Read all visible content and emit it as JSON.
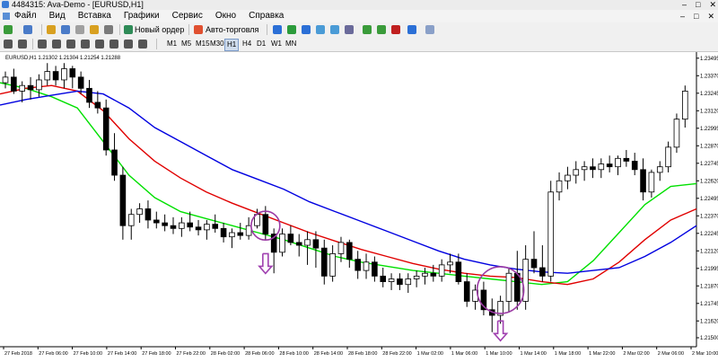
{
  "window": {
    "title": "4484315: Ava-Demo - [EURUSD,H1]",
    "buttons": [
      "–",
      "□",
      "✕"
    ]
  },
  "menu": {
    "items": [
      "Файл",
      "Вид",
      "Вставка",
      "Графики",
      "Сервис",
      "Окно",
      "Справка"
    ],
    "mdi": [
      "–",
      "□",
      "✕"
    ]
  },
  "toolbar": {
    "new_order": "Новый ордер",
    "auto_trading": "Авто-торговля"
  },
  "timeframes": [
    "M1",
    "M5",
    "M15",
    "M30",
    "H1",
    "H4",
    "D1",
    "W1",
    "MN"
  ],
  "chart_info": "EURUSD,H1  1.21302 1.21304 1.21254 1.21288",
  "colors": {
    "bull": "#ffffff",
    "bear": "#000000",
    "ma_fast": "#00e000",
    "ma_mid": "#e00000",
    "ma_slow": "#0000e0",
    "annotation": "#9b3aa4",
    "arrow": "#a040b0"
  },
  "chart_data": {
    "type": "candlestick",
    "symbol": "EURUSD",
    "timeframe": "H1",
    "price_labels": [
      "1.23495",
      "1.23370",
      "1.23245",
      "1.23120",
      "1.22995",
      "1.22870",
      "1.22745",
      "1.22620",
      "1.22495",
      "1.22370",
      "1.22245",
      "1.22120",
      "1.21995",
      "1.21870",
      "1.21745",
      "1.21620",
      "1.21500"
    ],
    "ylim": [
      1.215,
      1.235
    ],
    "time_labels": [
      "27 Feb 2018",
      "27 Feb 06:00",
      "27 Feb 10:00",
      "27 Feb 14:00",
      "27 Feb 18:00",
      "27 Feb 22:00",
      "28 Feb 02:00",
      "28 Feb 06:00",
      "28 Feb 10:00",
      "28 Feb 14:00",
      "28 Feb 18:00",
      "28 Feb 22:00",
      "1 Mar 02:00",
      "1 Mar 06:00",
      "1 Mar 10:00",
      "1 Mar 14:00",
      "1 Mar 18:00",
      "1 Mar 22:00",
      "2 Mar 02:00",
      "2 Mar 06:00",
      "2 Mar 10:00"
    ],
    "candles": [
      [
        1.2332,
        1.234,
        1.2328,
        1.2336
      ],
      [
        1.2336,
        1.2342,
        1.2324,
        1.2326
      ],
      [
        1.2326,
        1.2333,
        1.2318,
        1.233
      ],
      [
        1.233,
        1.2336,
        1.232,
        1.2327
      ],
      [
        1.2327,
        1.2338,
        1.2322,
        1.2334
      ],
      [
        1.2334,
        1.2346,
        1.233,
        1.234
      ],
      [
        1.234,
        1.2344,
        1.233,
        1.2334
      ],
      [
        1.2334,
        1.2346,
        1.2328,
        1.2342
      ],
      [
        1.2342,
        1.2344,
        1.2328,
        1.2336
      ],
      [
        1.2336,
        1.234,
        1.2324,
        1.2328
      ],
      [
        1.2328,
        1.2334,
        1.2314,
        1.2318
      ],
      [
        1.2318,
        1.2326,
        1.231,
        1.2314
      ],
      [
        1.2314,
        1.232,
        1.228,
        1.2284
      ],
      [
        1.2284,
        1.2296,
        1.2262,
        1.2266
      ],
      [
        1.2266,
        1.2272,
        1.222,
        1.223
      ],
      [
        1.223,
        1.2242,
        1.222,
        1.2238
      ],
      [
        1.2238,
        1.2246,
        1.2232,
        1.2242
      ],
      [
        1.2242,
        1.2248,
        1.2228,
        1.2234
      ],
      [
        1.2234,
        1.224,
        1.2228,
        1.2232
      ],
      [
        1.2232,
        1.2238,
        1.2226,
        1.223
      ],
      [
        1.223,
        1.2236,
        1.2224,
        1.2228
      ],
      [
        1.2228,
        1.2236,
        1.2222,
        1.2232
      ],
      [
        1.2232,
        1.224,
        1.2226,
        1.2229
      ],
      [
        1.2229,
        1.2234,
        1.2223,
        1.2227
      ],
      [
        1.2227,
        1.2234,
        1.222,
        1.2231
      ],
      [
        1.2231,
        1.2238,
        1.2225,
        1.2228
      ],
      [
        1.2228,
        1.2232,
        1.2218,
        1.2222
      ],
      [
        1.2222,
        1.2228,
        1.2214,
        1.2225
      ],
      [
        1.2225,
        1.2232,
        1.222,
        1.2223
      ],
      [
        1.2223,
        1.2236,
        1.222,
        1.223
      ],
      [
        1.223,
        1.2242,
        1.2228,
        1.2238
      ],
      [
        1.2238,
        1.2244,
        1.222,
        1.2224
      ],
      [
        1.2224,
        1.2228,
        1.2196,
        1.2211
      ],
      [
        1.2211,
        1.2228,
        1.2208,
        1.2224
      ],
      [
        1.2224,
        1.223,
        1.2216,
        1.2218
      ],
      [
        1.2218,
        1.2224,
        1.2208,
        1.2216
      ],
      [
        1.2216,
        1.2226,
        1.2202,
        1.222
      ],
      [
        1.222,
        1.2226,
        1.22,
        1.2214
      ],
      [
        1.2214,
        1.222,
        1.2188,
        1.2194
      ],
      [
        1.2194,
        1.2216,
        1.219,
        1.221
      ],
      [
        1.221,
        1.2222,
        1.2204,
        1.2218
      ],
      [
        1.2218,
        1.222,
        1.22,
        1.2206
      ],
      [
        1.2206,
        1.2212,
        1.2192,
        1.2198
      ],
      [
        1.2198,
        1.221,
        1.2192,
        1.2204
      ],
      [
        1.2204,
        1.2208,
        1.219,
        1.2194
      ],
      [
        1.2194,
        1.22,
        1.2186,
        1.219
      ],
      [
        1.219,
        1.2196,
        1.2184,
        1.2192
      ],
      [
        1.2192,
        1.2196,
        1.2184,
        1.2188
      ],
      [
        1.2188,
        1.2196,
        1.2182,
        1.2192
      ],
      [
        1.2192,
        1.2198,
        1.2186,
        1.2194
      ],
      [
        1.2194,
        1.22,
        1.2188,
        1.2196
      ],
      [
        1.2196,
        1.2202,
        1.219,
        1.2194
      ],
      [
        1.2194,
        1.2206,
        1.219,
        1.2202
      ],
      [
        1.2202,
        1.221,
        1.2196,
        1.2204
      ],
      [
        1.2204,
        1.221,
        1.2188,
        1.219
      ],
      [
        1.219,
        1.2196,
        1.2172,
        1.2176
      ],
      [
        1.2176,
        1.2188,
        1.217,
        1.2184
      ],
      [
        1.2184,
        1.219,
        1.2166,
        1.217
      ],
      [
        1.217,
        1.2178,
        1.2154,
        1.2166
      ],
      [
        1.2166,
        1.218,
        1.216,
        1.2176
      ],
      [
        1.2176,
        1.22,
        1.2168,
        1.2196
      ],
      [
        1.2196,
        1.2212,
        1.217,
        1.2176
      ],
      [
        1.2176,
        1.2216,
        1.217,
        1.2206
      ],
      [
        1.2206,
        1.2226,
        1.2196,
        1.22
      ],
      [
        1.22,
        1.2216,
        1.219,
        1.2194
      ],
      [
        1.2194,
        1.2262,
        1.219,
        1.2254
      ],
      [
        1.2254,
        1.2268,
        1.2248,
        1.2262
      ],
      [
        1.2262,
        1.2272,
        1.2256,
        1.2266
      ],
      [
        1.2266,
        1.2276,
        1.226,
        1.227
      ],
      [
        1.227,
        1.2276,
        1.2262,
        1.2272
      ],
      [
        1.2272,
        1.2278,
        1.2264,
        1.227
      ],
      [
        1.227,
        1.2278,
        1.2264,
        1.2274
      ],
      [
        1.2274,
        1.228,
        1.2268,
        1.2272
      ],
      [
        1.2272,
        1.228,
        1.2266,
        1.2278
      ],
      [
        1.2278,
        1.2284,
        1.2272,
        1.2276
      ],
      [
        1.2276,
        1.2282,
        1.2266,
        1.227
      ],
      [
        1.227,
        1.2278,
        1.2248,
        1.2254
      ],
      [
        1.2254,
        1.227,
        1.225,
        1.2268
      ],
      [
        1.2268,
        1.2276,
        1.2262,
        1.2272
      ],
      [
        1.2272,
        1.229,
        1.2268,
        1.2286
      ],
      [
        1.2286,
        1.231,
        1.2282,
        1.2306
      ],
      [
        1.2306,
        1.233,
        1.23,
        1.2326
      ]
    ],
    "series": [
      {
        "name": "MA fast",
        "color": "#00e000",
        "values": [
          1.2332,
          1.2328,
          1.2322,
          1.2314,
          1.229,
          1.2266,
          1.225,
          1.224,
          1.2235,
          1.223,
          1.2225,
          1.222,
          1.2214,
          1.2208,
          1.2204,
          1.2201,
          1.2198,
          1.2196,
          1.2194,
          1.2192,
          1.219,
          1.2188,
          1.219,
          1.2205,
          1.2225,
          1.2245,
          1.2258,
          1.226
        ]
      },
      {
        "name": "MA mid",
        "color": "#e00000",
        "values": [
          1.2324,
          1.2328,
          1.233,
          1.2326,
          1.2312,
          1.2292,
          1.2276,
          1.2264,
          1.2254,
          1.2246,
          1.2239,
          1.2232,
          1.2225,
          1.2219,
          1.2213,
          1.2208,
          1.2203,
          1.2199,
          1.2196,
          1.2194,
          1.2193,
          1.219,
          1.2188,
          1.2192,
          1.2204,
          1.222,
          1.2234,
          1.2242
        ]
      },
      {
        "name": "MA slow",
        "color": "#0000e0",
        "values": [
          1.2316,
          1.232,
          1.2323,
          1.2326,
          1.2324,
          1.2314,
          1.23,
          1.229,
          1.228,
          1.227,
          1.2263,
          1.2256,
          1.2247,
          1.224,
          1.2233,
          1.2226,
          1.2219,
          1.2212,
          1.2206,
          1.2202,
          1.2199,
          1.2197,
          1.2196,
          1.2198,
          1.22,
          1.2208,
          1.2218,
          1.223
        ]
      }
    ],
    "annotations": {
      "circles": 3,
      "down_arrows": 2
    }
  }
}
